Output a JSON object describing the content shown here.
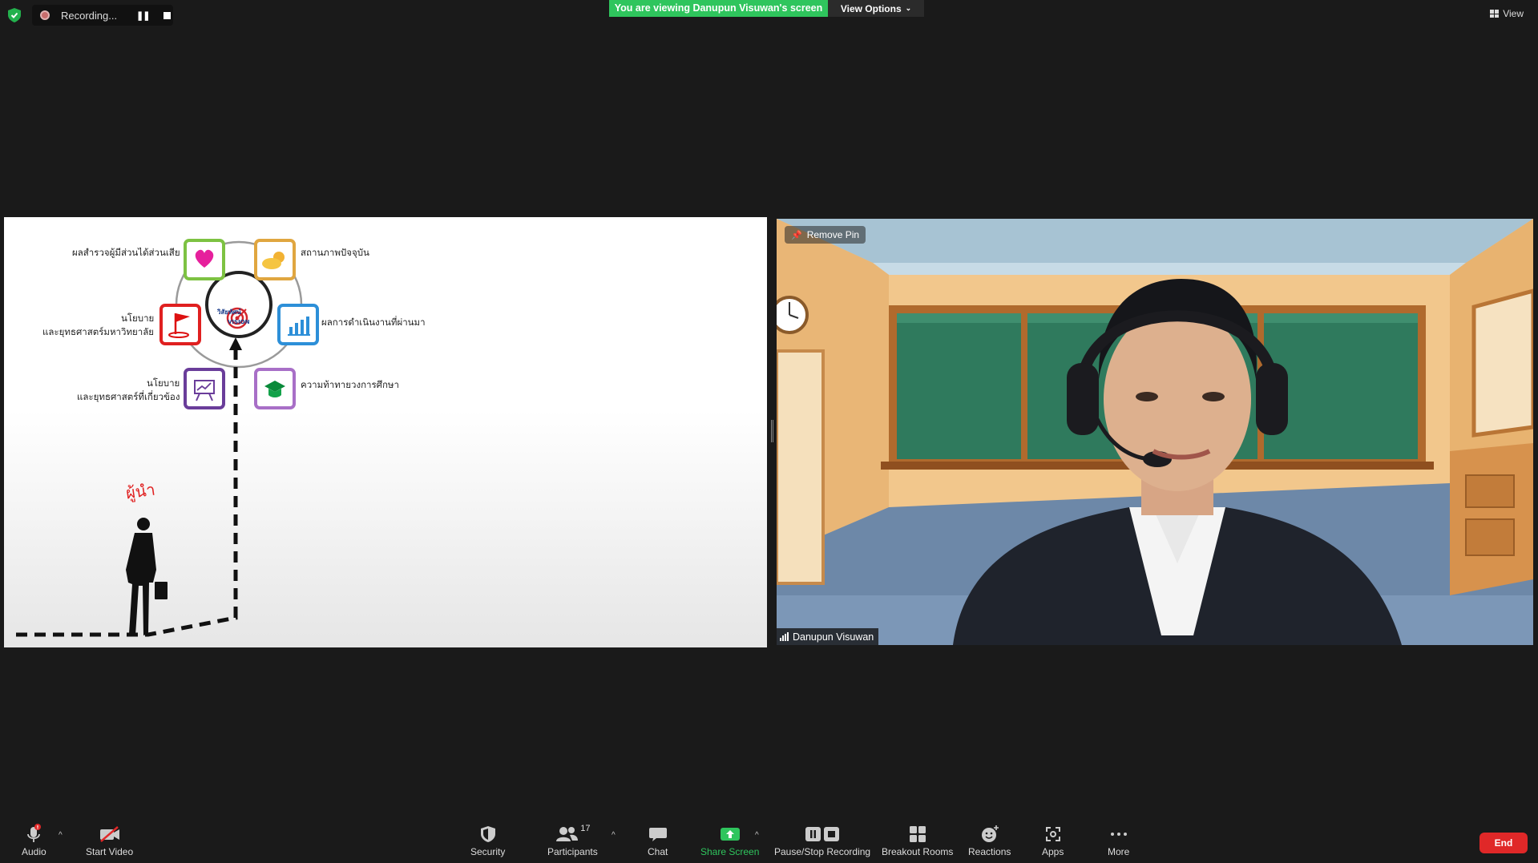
{
  "recording": {
    "label": "Recording..."
  },
  "banner": {
    "viewing_text": "You are viewing Danupun Visuwan's screen",
    "view_options": "View Options"
  },
  "view": {
    "label": "View"
  },
  "slide": {
    "center_title": "วิสัยทัศน์",
    "center_subtitle": "VISION",
    "handwriting": "ผู้นำ",
    "labels": {
      "stakeholder": "ผลสำรวจผู้มีส่วนได้ส่วนเสีย",
      "current_state": "สถานภาพปัจจุบัน",
      "policy1_line1": "นโยบาย",
      "policy1_line2": "และยุทธศาสตร์มหาวิทยาลัย",
      "performance": "ผลการดำเนินงานที่ผ่านมา",
      "policy2_line1": "นโยบาย",
      "policy2_line2": "และยุทธศาสตร์ที่เกี่ยวข้อง",
      "challenge": "ความท้าทายวงการศึกษา"
    }
  },
  "video": {
    "remove_pin": "Remove Pin",
    "participant_name": "Danupun Visuwan"
  },
  "toolbar": {
    "audio": "Audio",
    "start_video": "Start Video",
    "security": "Security",
    "participants": "Participants",
    "participants_count": "17",
    "chat": "Chat",
    "share_screen": "Share Screen",
    "pause_stop": "Pause/Stop Recording",
    "breakout": "Breakout Rooms",
    "reactions": "Reactions",
    "apps": "Apps",
    "more": "More",
    "end": "End"
  },
  "colors": {
    "share_green": "#2fc55d",
    "end_red": "#e02828",
    "banner_green": "#2fc55d"
  }
}
